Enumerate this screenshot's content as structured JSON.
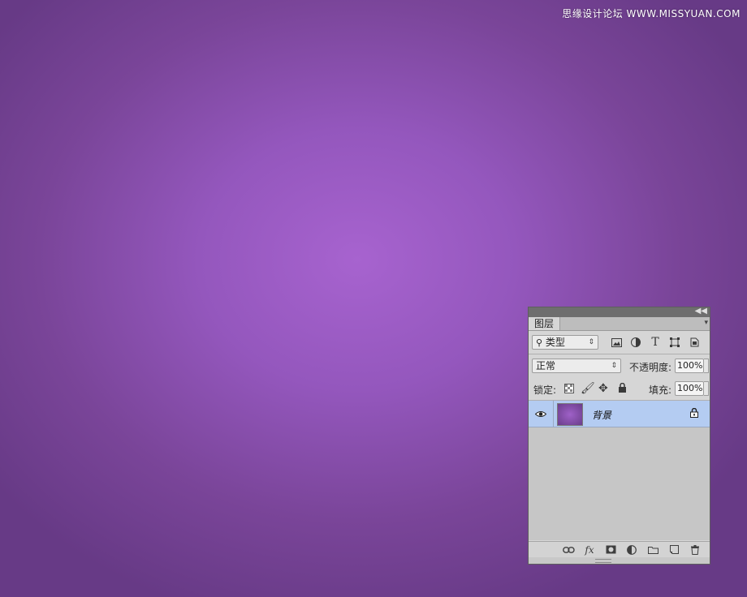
{
  "watermark": "思缘设计论坛 WWW.MISSYUAN.COM",
  "colors": {
    "canvas_center": "#a763cf",
    "canvas_edge": "#673a86",
    "layer_selected": "#b4ccf2"
  },
  "panel": {
    "tab_label": "图层",
    "filter": {
      "selected": "类型"
    },
    "filter_icons": [
      "image-filter-icon",
      "adjustment-filter-icon",
      "type-filter-icon",
      "shape-filter-icon",
      "smart-object-filter-icon"
    ],
    "blend_mode": "正常",
    "opacity_label": "不透明度:",
    "opacity_value": "100%",
    "lock_label": "锁定:",
    "fill_label": "填充:",
    "fill_value": "100%",
    "layers": [
      {
        "name": "背景",
        "visible": true,
        "locked": true,
        "selected": true
      }
    ],
    "bottom_icons": [
      "link-layers-icon",
      "fx-icon",
      "mask-icon",
      "adjustment-layer-icon",
      "group-folder-icon",
      "new-layer-icon",
      "trash-icon"
    ]
  }
}
